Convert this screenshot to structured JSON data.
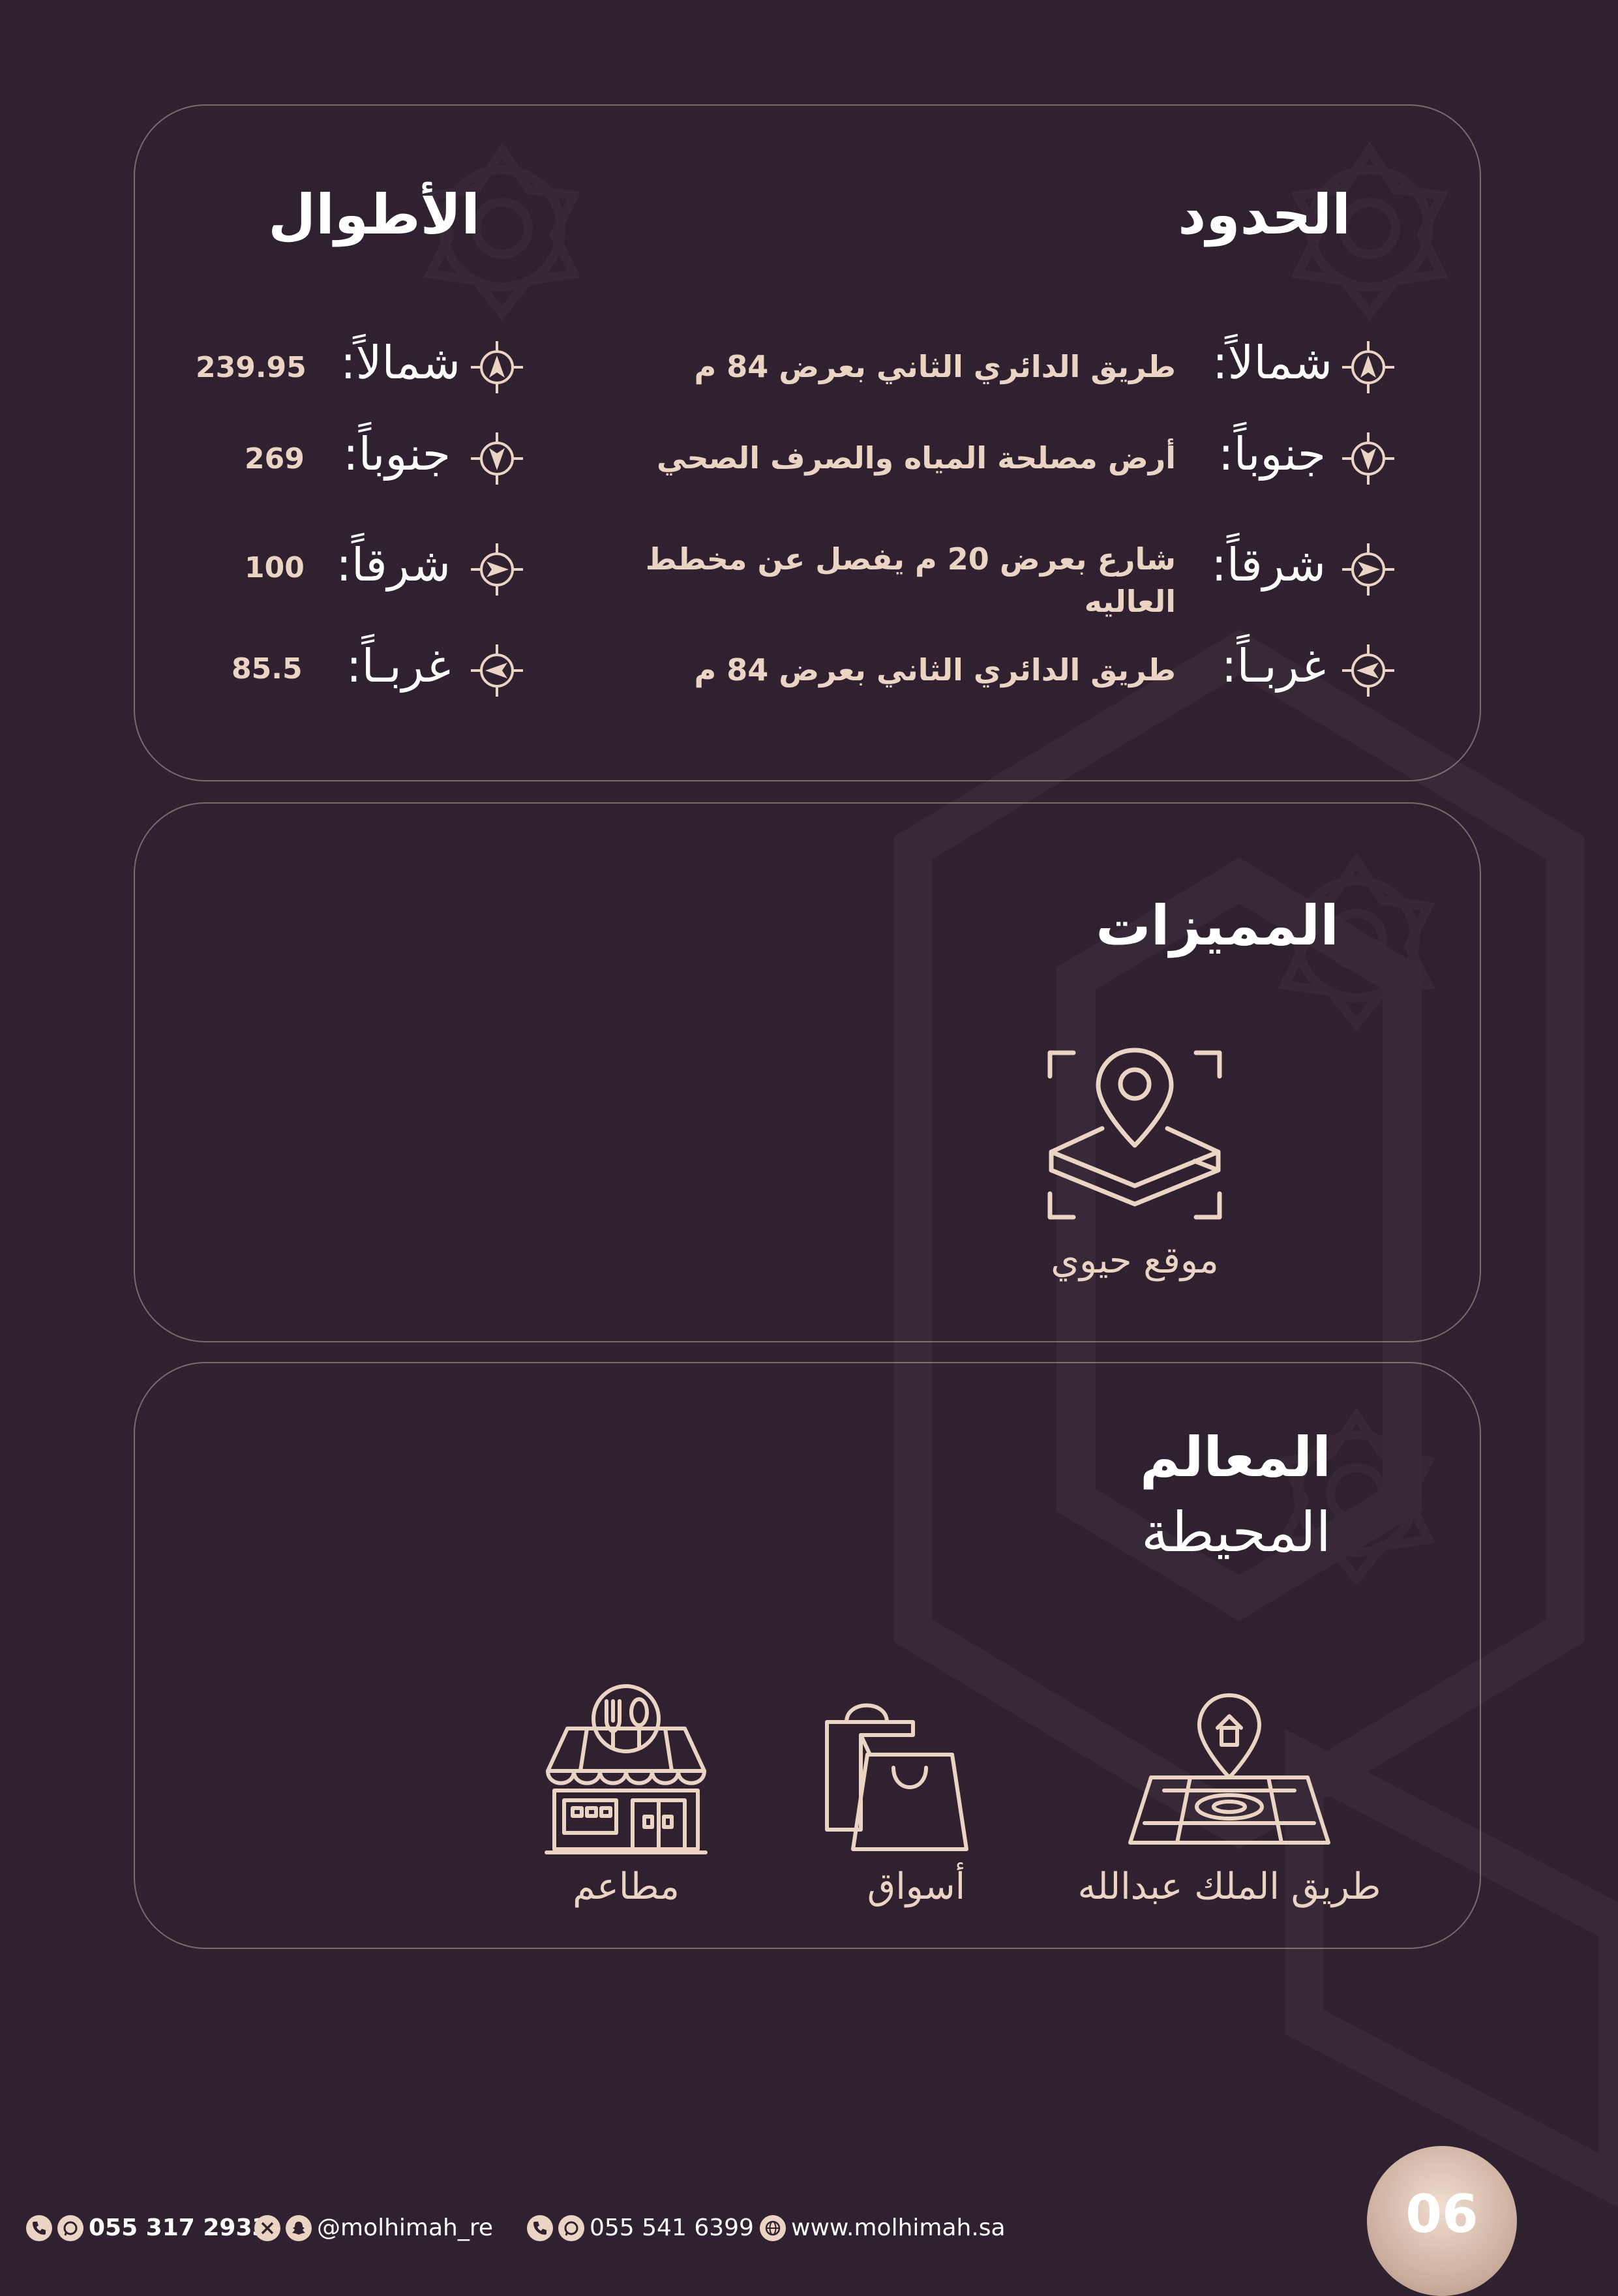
{
  "colors": {
    "background": "#2f212f",
    "accent": "#ecd4c4",
    "card_border": "#b99f95"
  },
  "borders": {
    "title": "الحدود",
    "rows": [
      {
        "label": "شمالاً:",
        "value": "طريق الدائري الثاني بعرض 84 م",
        "icon": "compass-north-icon"
      },
      {
        "label": "جنوباً:",
        "value": "أرض مصلحة المياه والصرف الصحي",
        "icon": "compass-south-icon"
      },
      {
        "label": "شرقاً:",
        "value": "شارع بعرض 20 م يفصل عن مخطط",
        "value2": "العاليه",
        "icon": "compass-east-icon"
      },
      {
        "label": "غربـاً:",
        "value": "طريق الدائري الثاني بعرض 84 م",
        "icon": "compass-west-icon"
      }
    ]
  },
  "lengths": {
    "title": "الأطوال",
    "rows": [
      {
        "label": "شمالاً:",
        "value": "239.95"
      },
      {
        "label": "جنوباً:",
        "value": "269"
      },
      {
        "label": "شرقاً:",
        "value": "100"
      },
      {
        "label": "غربـاً:",
        "value": "85.5"
      }
    ]
  },
  "features": {
    "title": "المميزات",
    "items": [
      {
        "label": "موقع حيوي",
        "icon": "map-location-pin-icon"
      }
    ]
  },
  "landmarks": {
    "title": "المعالم",
    "subtitle": "المحيطة",
    "items": [
      {
        "label": "طريق الملك عبدالله",
        "icon": "road-map-pin-icon"
      },
      {
        "label": "أسواق",
        "icon": "shopping-bags-icon"
      },
      {
        "label": "مطاعم",
        "icon": "restaurant-icon"
      }
    ]
  },
  "footer": {
    "phone1": "055 317 2933",
    "handle": "@molhimah_re",
    "phone2": "055 541 6399",
    "website": "www.molhimah.sa"
  },
  "page_number": "06"
}
